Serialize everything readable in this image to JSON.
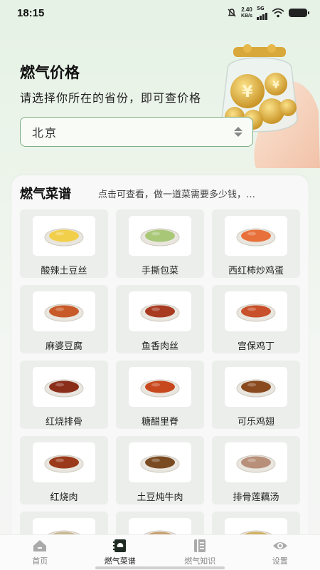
{
  "status_bar": {
    "time": "18:15",
    "net_speed_value": "2.40",
    "net_speed_unit": "KB/s",
    "network_type": "5G"
  },
  "hero": {
    "title": "燃气价格",
    "subtitle": "请选择你所在的省份，即可查价格",
    "province_selected": "北京"
  },
  "recipes": {
    "title": "燃气菜谱",
    "description": "点击可查看，做一道菜需要多少钱，…",
    "items": [
      {
        "name": "酸辣土豆丝",
        "color": "#f2cf4a"
      },
      {
        "name": "手撕包菜",
        "color": "#a8c878"
      },
      {
        "name": "西红柿炒鸡蛋",
        "color": "#e8703a"
      },
      {
        "name": "麻婆豆腐",
        "color": "#c85a2a"
      },
      {
        "name": "鱼香肉丝",
        "color": "#a83a22"
      },
      {
        "name": "宫保鸡丁",
        "color": "#c8502a"
      },
      {
        "name": "红烧排骨",
        "color": "#8a2e1a"
      },
      {
        "name": "糖醋里脊",
        "color": "#c8481e"
      },
      {
        "name": "可乐鸡翅",
        "color": "#8a4a1e"
      },
      {
        "name": "红烧肉",
        "color": "#9a3a1a"
      },
      {
        "name": "土豆炖牛肉",
        "color": "#7a4a22"
      },
      {
        "name": "排骨莲藕汤",
        "color": "#b8907a"
      },
      {
        "name": "",
        "color": "#c8b890"
      },
      {
        "name": "",
        "color": "#c8a070"
      },
      {
        "name": "",
        "color": "#d0b060"
      }
    ]
  },
  "nav": {
    "items": [
      {
        "label": "首页",
        "icon": "home-icon"
      },
      {
        "label": "燃气菜谱",
        "icon": "recipe-icon"
      },
      {
        "label": "燃气知识",
        "icon": "book-icon"
      },
      {
        "label": "设置",
        "icon": "eye-icon"
      }
    ],
    "active_index": 1
  },
  "colors": {
    "accent_green": "#7fae83",
    "coin_gold": "#e0b040"
  }
}
